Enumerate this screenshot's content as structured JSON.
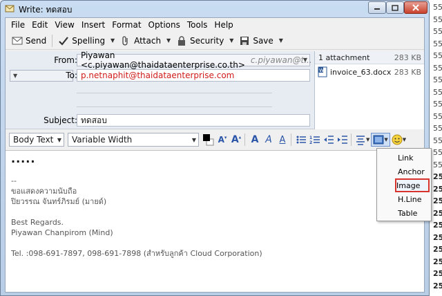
{
  "window": {
    "title": "Write: ทดสอบ"
  },
  "menubar": [
    "File",
    "Edit",
    "View",
    "Insert",
    "Format",
    "Options",
    "Tools",
    "Help"
  ],
  "toolbar": {
    "send": "Send",
    "spelling": "Spelling",
    "attach": "Attach",
    "security": "Security",
    "save": "Save"
  },
  "header": {
    "from_label": "From:",
    "from_value": "Piyawan <c.piyawan@thaidataenterprise.co.th>",
    "from_identity": "c.piyawan@t...",
    "to_label": "To:",
    "to_value": "p.netnaphit@thaidataenterprise.com",
    "subject_label": "Subject:",
    "subject_value": "ทดสอบ"
  },
  "attachments": {
    "count_label": "1 attachment",
    "total_size": "283 KB",
    "items": [
      {
        "name": "invoice_63.docx",
        "size": "283 KB"
      }
    ]
  },
  "format_bar": {
    "paragraph_style": "Body Text",
    "font": "Variable Width"
  },
  "editor": {
    "lines": [
      "-- ",
      "ขอแสดงความนับถือ",
      "ปิยวรรณ จันทร์ภิรมย์ (มายด์)",
      "",
      "Best Regards.",
      "Piyawan Chanpirom (Mind)",
      "",
      "Tel. :098-691-7897, 098-691-7898 (สำหรับลูกค้า Cloud Corporation)"
    ],
    "leading_dots": "....."
  },
  "insert_menu": {
    "items": [
      "Link",
      "Anchor",
      "Image",
      "H.Line",
      "Table"
    ],
    "highlighted": "Image"
  },
  "background_strip": [
    "55",
    "55",
    "55",
    "55",
    "55",
    "55",
    "55",
    "55",
    "55",
    "55",
    "55",
    "55",
    "55",
    "55",
    "25",
    "25",
    "25",
    "25",
    "25",
    "25",
    "25",
    "25",
    "25",
    "25"
  ],
  "colors": {
    "to_text": "#d11a1a",
    "highlight_outline": "#d9342b",
    "accent_blue": "#2a55a8"
  }
}
